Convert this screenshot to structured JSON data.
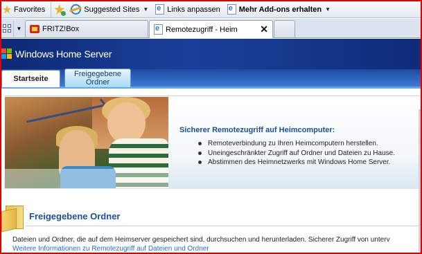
{
  "favorites_bar": {
    "favorites_label": "Favorites",
    "items": [
      {
        "label": "Suggested Sites",
        "icon": "ie-icon",
        "has_dropdown": true
      },
      {
        "label": "Links anpassen",
        "icon": "page-icon",
        "has_dropdown": false
      },
      {
        "label": "Mehr Add-ons erhalten",
        "icon": "page-icon",
        "has_dropdown": true
      }
    ]
  },
  "browser_tabs": [
    {
      "label": "FRITZ!Box",
      "icon": "fritzbox-icon",
      "active": false
    },
    {
      "label": "Remotezugriff - Heim",
      "icon": "page-icon",
      "active": true,
      "close_glyph": "✕"
    }
  ],
  "site": {
    "title": "Windows Home Server",
    "logo_colors": [
      "#f25022",
      "#7fba00",
      "#00a4ef",
      "#ffb900"
    ],
    "nav_tabs": [
      {
        "label": "Startseite",
        "active": true
      },
      {
        "label_line1": "Freigegebene",
        "label_line2": "Ordner",
        "active": false
      }
    ]
  },
  "hero": {
    "heading": "Sicherer Remotezugriff auf Heimcomputer:",
    "bullets": [
      "Remoteverbindung zu Ihren Heimcomputern herstellen.",
      "Uneingeschränkter Zugriff auf Ordner und Dateien zu Hause.",
      "Abstimmen des Heimnetzwerks mit Windows Home Server."
    ]
  },
  "shared_folders": {
    "title": "Freigegebene Ordner",
    "description": "Dateien und Ordner, die auf dem Heimserver gespeichert sind, durchsuchen und herunterladen. Sicherer Zugriff von unterv",
    "more_link": "Weitere Informationen zu Remotezugriff auf Dateien und Ordner"
  },
  "colors": {
    "header_blue": "#0d2a76",
    "accent_blue": "#1a4fa0",
    "link_blue": "#1a6ed0",
    "frame_red": "#e00000"
  }
}
